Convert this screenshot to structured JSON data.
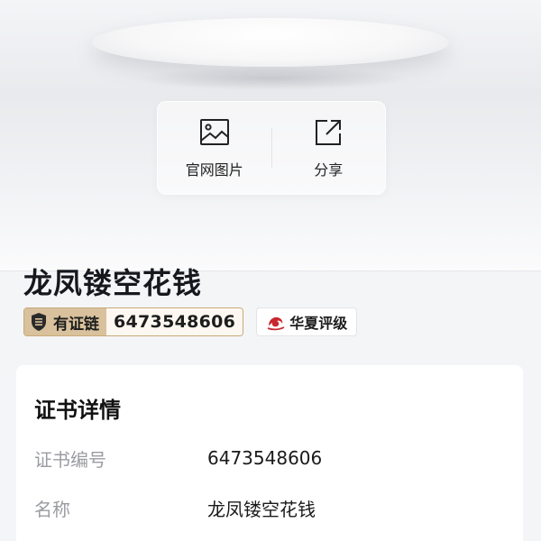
{
  "hero": {
    "actions": [
      {
        "label": "官网图片",
        "icon": "image-icon"
      },
      {
        "label": "分享",
        "icon": "share-icon"
      }
    ]
  },
  "item": {
    "title": "龙凤镂空花钱",
    "chain_badge": {
      "label": "有证链",
      "number": "6473548606",
      "icon": "certificate-shield-icon"
    },
    "rating_badge": {
      "label": "华夏评级",
      "icon": "huaxia-dragon-logo-icon"
    }
  },
  "details": {
    "title": "证书详情",
    "rows": [
      {
        "key": "证书编号",
        "value": "6473548606"
      },
      {
        "key": "名称",
        "value": "龙凤镂空花钱"
      }
    ]
  },
  "colors": {
    "accent_gold": "#d8c19c",
    "brand_red": "#c8282e",
    "muted_text": "#9a9ca1"
  }
}
